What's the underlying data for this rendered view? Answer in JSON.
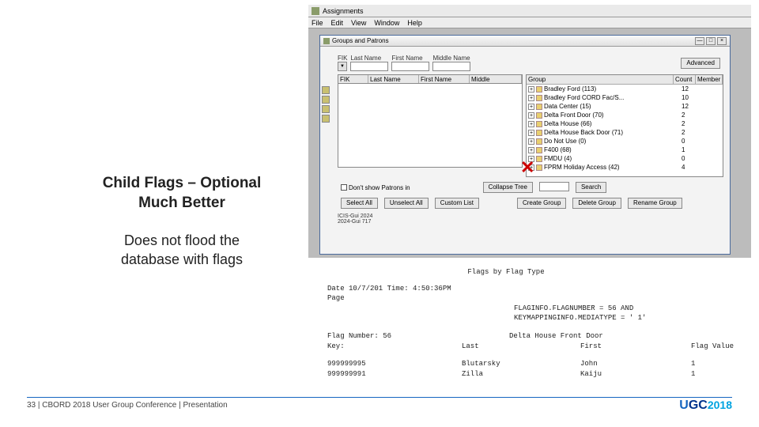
{
  "slide": {
    "title_line1": "Child Flags – Optional",
    "title_line2": "Much Better",
    "sub_line1": "Does not flood the",
    "sub_line2": "database with flags"
  },
  "app": {
    "title": "Assignments",
    "menus": [
      "File",
      "Edit",
      "View",
      "Window",
      "Help"
    ]
  },
  "inner_window": {
    "title": "Groups and Patrons",
    "search_fields": [
      "FIK",
      "Last Name",
      "First Name",
      "Middle Name"
    ],
    "advanced_btn": "Advanced",
    "table_cols": [
      "FIK",
      "Last Name",
      "First Name",
      "Middle"
    ],
    "tree_cols": [
      "Group",
      "Count",
      "Member"
    ],
    "groups": [
      {
        "name": "Bradley Ford (113)",
        "count": "12"
      },
      {
        "name": "Bradley Ford CORD Fac/S...",
        "count": "10"
      },
      {
        "name": "Data Center (15)",
        "count": "12"
      },
      {
        "name": "Delta Front Door (70)",
        "count": "2"
      },
      {
        "name": "Delta House (66)",
        "count": "2"
      },
      {
        "name": "Delta House Back Door (71)",
        "count": "2"
      },
      {
        "name": "Do Not Use (0)",
        "count": "0"
      },
      {
        "name": "F400 (68)",
        "count": "1"
      },
      {
        "name": "FMDU (4)",
        "count": "0"
      },
      {
        "name": "FPRM Holiday Access (42)",
        "count": "4"
      }
    ],
    "dont_show": "Don't show Patrons in",
    "collapse": "Collapse Tree",
    "search": "Search",
    "select_all": "Select All",
    "unselect_all": "Unselect All",
    "custom_list": "Custom List",
    "create_group": "Create Group",
    "delete_group": "Delete Group",
    "rename_group": "Rename Group",
    "icis": "ICIS-Gui 2024",
    "icis2": "2024-Gui 717"
  },
  "report": {
    "title": "Flags by Flag Type",
    "date_line": "Date 10/7/201  Time: 4:50:36PM",
    "page": "Page",
    "filter1": "FLAGINFO.FLAGNUMBER = 56 AND",
    "filter2": "KEYMAPPINGINFO.MEDIATYPE = ' 1'",
    "flag_num_label": "Flag Number: 56",
    "flag_name": "Delta House Front Door",
    "cols": [
      "Key:",
      "Last",
      "First",
      "Flag Value"
    ],
    "rows": [
      {
        "key": "999999995",
        "last": "Blutarsky",
        "first": "John",
        "val": "1"
      },
      {
        "key": "999999991",
        "last": "Zilla",
        "first": "Kaiju",
        "val": "1"
      }
    ]
  },
  "footer": {
    "page_num": "33",
    "text": "CBORD 2018 User Group Conference | Presentation",
    "logo_u": "U",
    "logo_gc": "GC",
    "logo_y": "2018"
  }
}
